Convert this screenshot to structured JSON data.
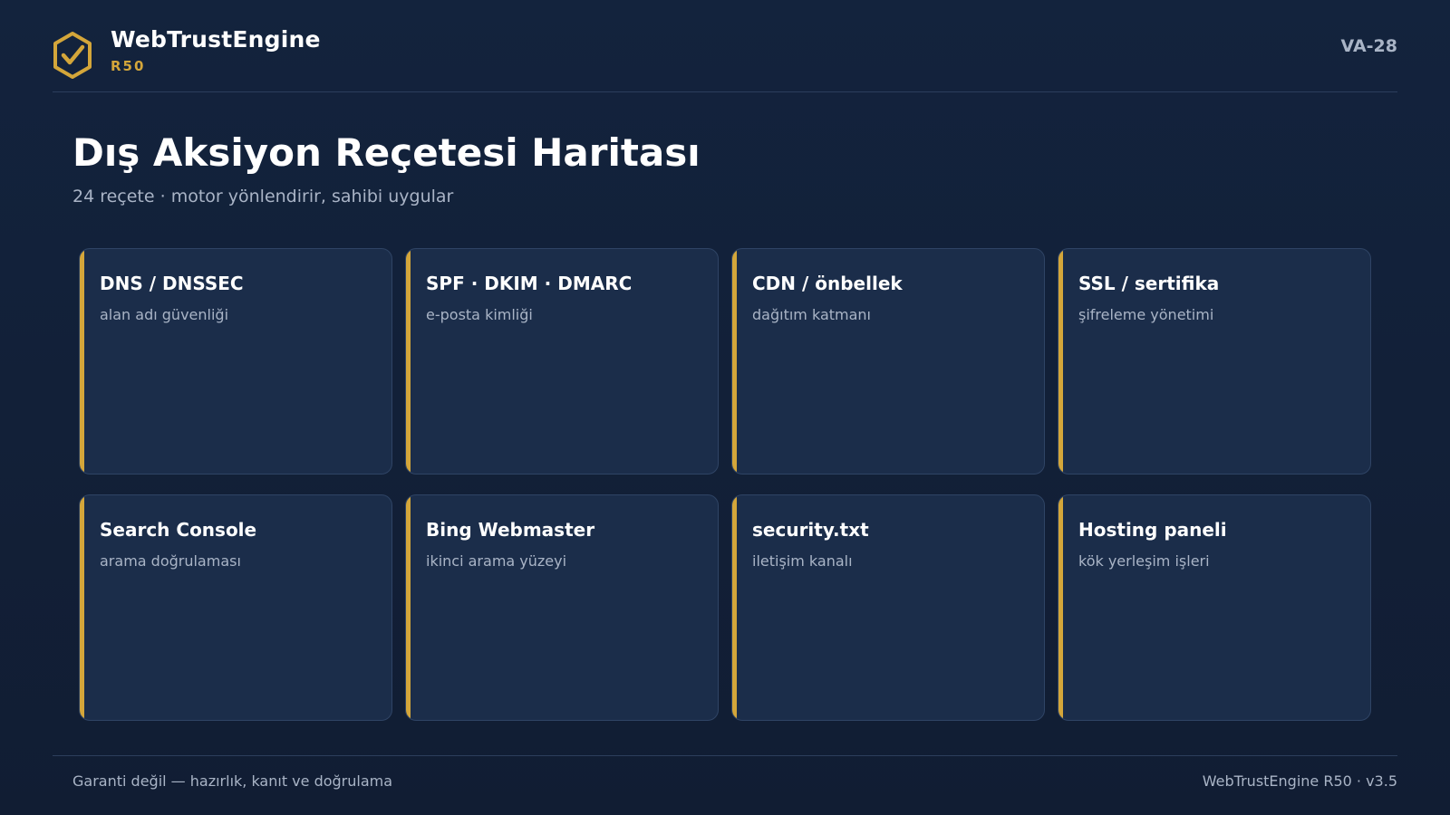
{
  "header": {
    "brand_name": "WebTrustEngine",
    "brand_version": "R50",
    "doc_code": "VA-28",
    "logo_icon": "hexagon-check-icon"
  },
  "main": {
    "title": "Dış Aksiyon Reçetesi Haritası",
    "subtitle": "24 reçete · motor yönlendirir, sahibi uygular"
  },
  "cards": [
    {
      "title": "DNS / DNSSEC",
      "subtitle": "alan adı güvenliği"
    },
    {
      "title": "SPF · DKIM · DMARC",
      "subtitle": "e-posta kimliği"
    },
    {
      "title": "CDN / önbellek",
      "subtitle": "dağıtım katmanı"
    },
    {
      "title": "SSL / sertifika",
      "subtitle": "şifreleme yönetimi"
    },
    {
      "title": "Search Console",
      "subtitle": "arama doğrulaması"
    },
    {
      "title": "Bing Webmaster",
      "subtitle": "ikinci arama yüzeyi"
    },
    {
      "title": "security.txt",
      "subtitle": "iletişim kanalı"
    },
    {
      "title": "Hosting paneli",
      "subtitle": "kök yerleşim işleri"
    }
  ],
  "footer": {
    "left": "Garanti değil — hazırlık, kanıt ve doğrulama",
    "right": "WebTrustEngine R50 · v3.5"
  },
  "colors": {
    "background": "#13233d",
    "card": "#1b2d4a",
    "accent": "#d4a63a",
    "muted_text": "#a9b4c6"
  }
}
